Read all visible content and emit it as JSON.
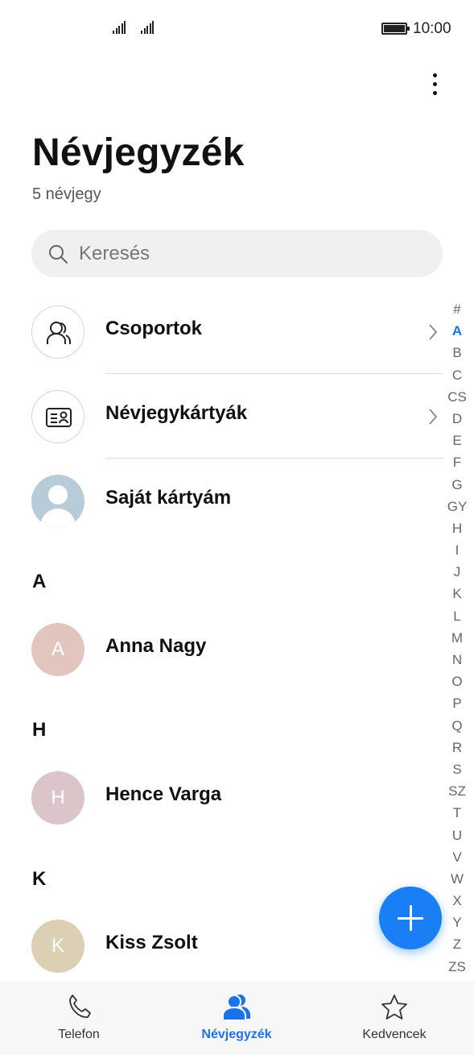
{
  "status_bar": {
    "time": "10:00"
  },
  "header": {
    "title": "Névjegyzék",
    "subtitle": "5 névjegy"
  },
  "search": {
    "placeholder": "Keresés"
  },
  "quick_rows": [
    {
      "label": "Csoportok",
      "icon": "groups-icon"
    },
    {
      "label": "Névjegykártyák",
      "icon": "business-card-icon"
    },
    {
      "label": "Saját kártyám",
      "icon": "my-card-avatar"
    }
  ],
  "sections": [
    {
      "letter": "A",
      "contacts": [
        {
          "name": "Anna Nagy",
          "initial": "A",
          "color": "#e2c6bd"
        }
      ]
    },
    {
      "letter": "H",
      "contacts": [
        {
          "name": "Hence Varga",
          "initial": "H",
          "color": "#dcc4cb"
        }
      ]
    },
    {
      "letter": "K",
      "contacts": [
        {
          "name": "Kiss Zsolt",
          "initial": "K",
          "color": "#dbd0b4"
        }
      ]
    }
  ],
  "alpha_index": [
    "#",
    "A",
    "B",
    "C",
    "CS",
    "D",
    "E",
    "F",
    "G",
    "GY",
    "H",
    "I",
    "J",
    "K",
    "L",
    "M",
    "N",
    "O",
    "P",
    "Q",
    "R",
    "S",
    "SZ",
    "T",
    "U",
    "V",
    "W",
    "X",
    "Y",
    "Z",
    "ZS"
  ],
  "alpha_active": "A",
  "bottom_nav": [
    {
      "label": "Telefon",
      "icon": "phone-icon"
    },
    {
      "label": "Névjegyzék",
      "icon": "contacts-icon",
      "active": true
    },
    {
      "label": "Kedvencek",
      "icon": "star-icon"
    }
  ],
  "colors": {
    "accent": "#1a73e8",
    "fab": "#1a7ff5"
  }
}
